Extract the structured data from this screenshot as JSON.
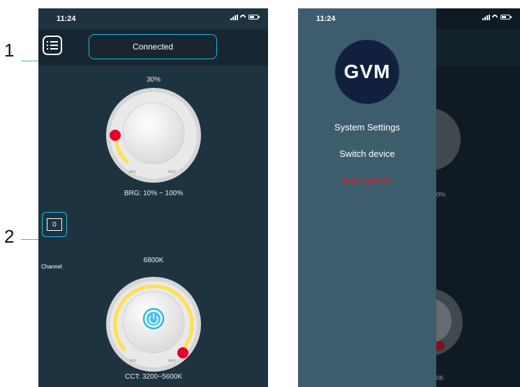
{
  "callouts": {
    "one": "1",
    "two": "2"
  },
  "left_screen": {
    "status_time": "11:24",
    "connection_status": "Connected",
    "brightness": {
      "value_label": "30%",
      "range_label": "BRG: 10% ~ 100%",
      "min_label": "MIN",
      "max_label": "MAX",
      "level_percent": 30
    },
    "channel": {
      "value": "0",
      "label": "Channel"
    },
    "cct": {
      "value_label": "6800K",
      "range_label": "CCT: 3200~5600K",
      "min_label": "MIN",
      "max_label": "MAX"
    }
  },
  "right_screen": {
    "status_time": "11:24",
    "drawer": {
      "logo": "GVM",
      "items": [
        "System Settings",
        "Switch device"
      ],
      "exit_label": "Exit System"
    },
    "background": {
      "brightness_fragment": "0%",
      "cct_fragment": "0K"
    }
  },
  "colors": {
    "accent": "#29b6e6",
    "background": "#1e3340",
    "drawer": "#3e5d6c",
    "exit": "#d11f2a",
    "indicator": "#e4002b",
    "arc": "#ffe04d"
  }
}
